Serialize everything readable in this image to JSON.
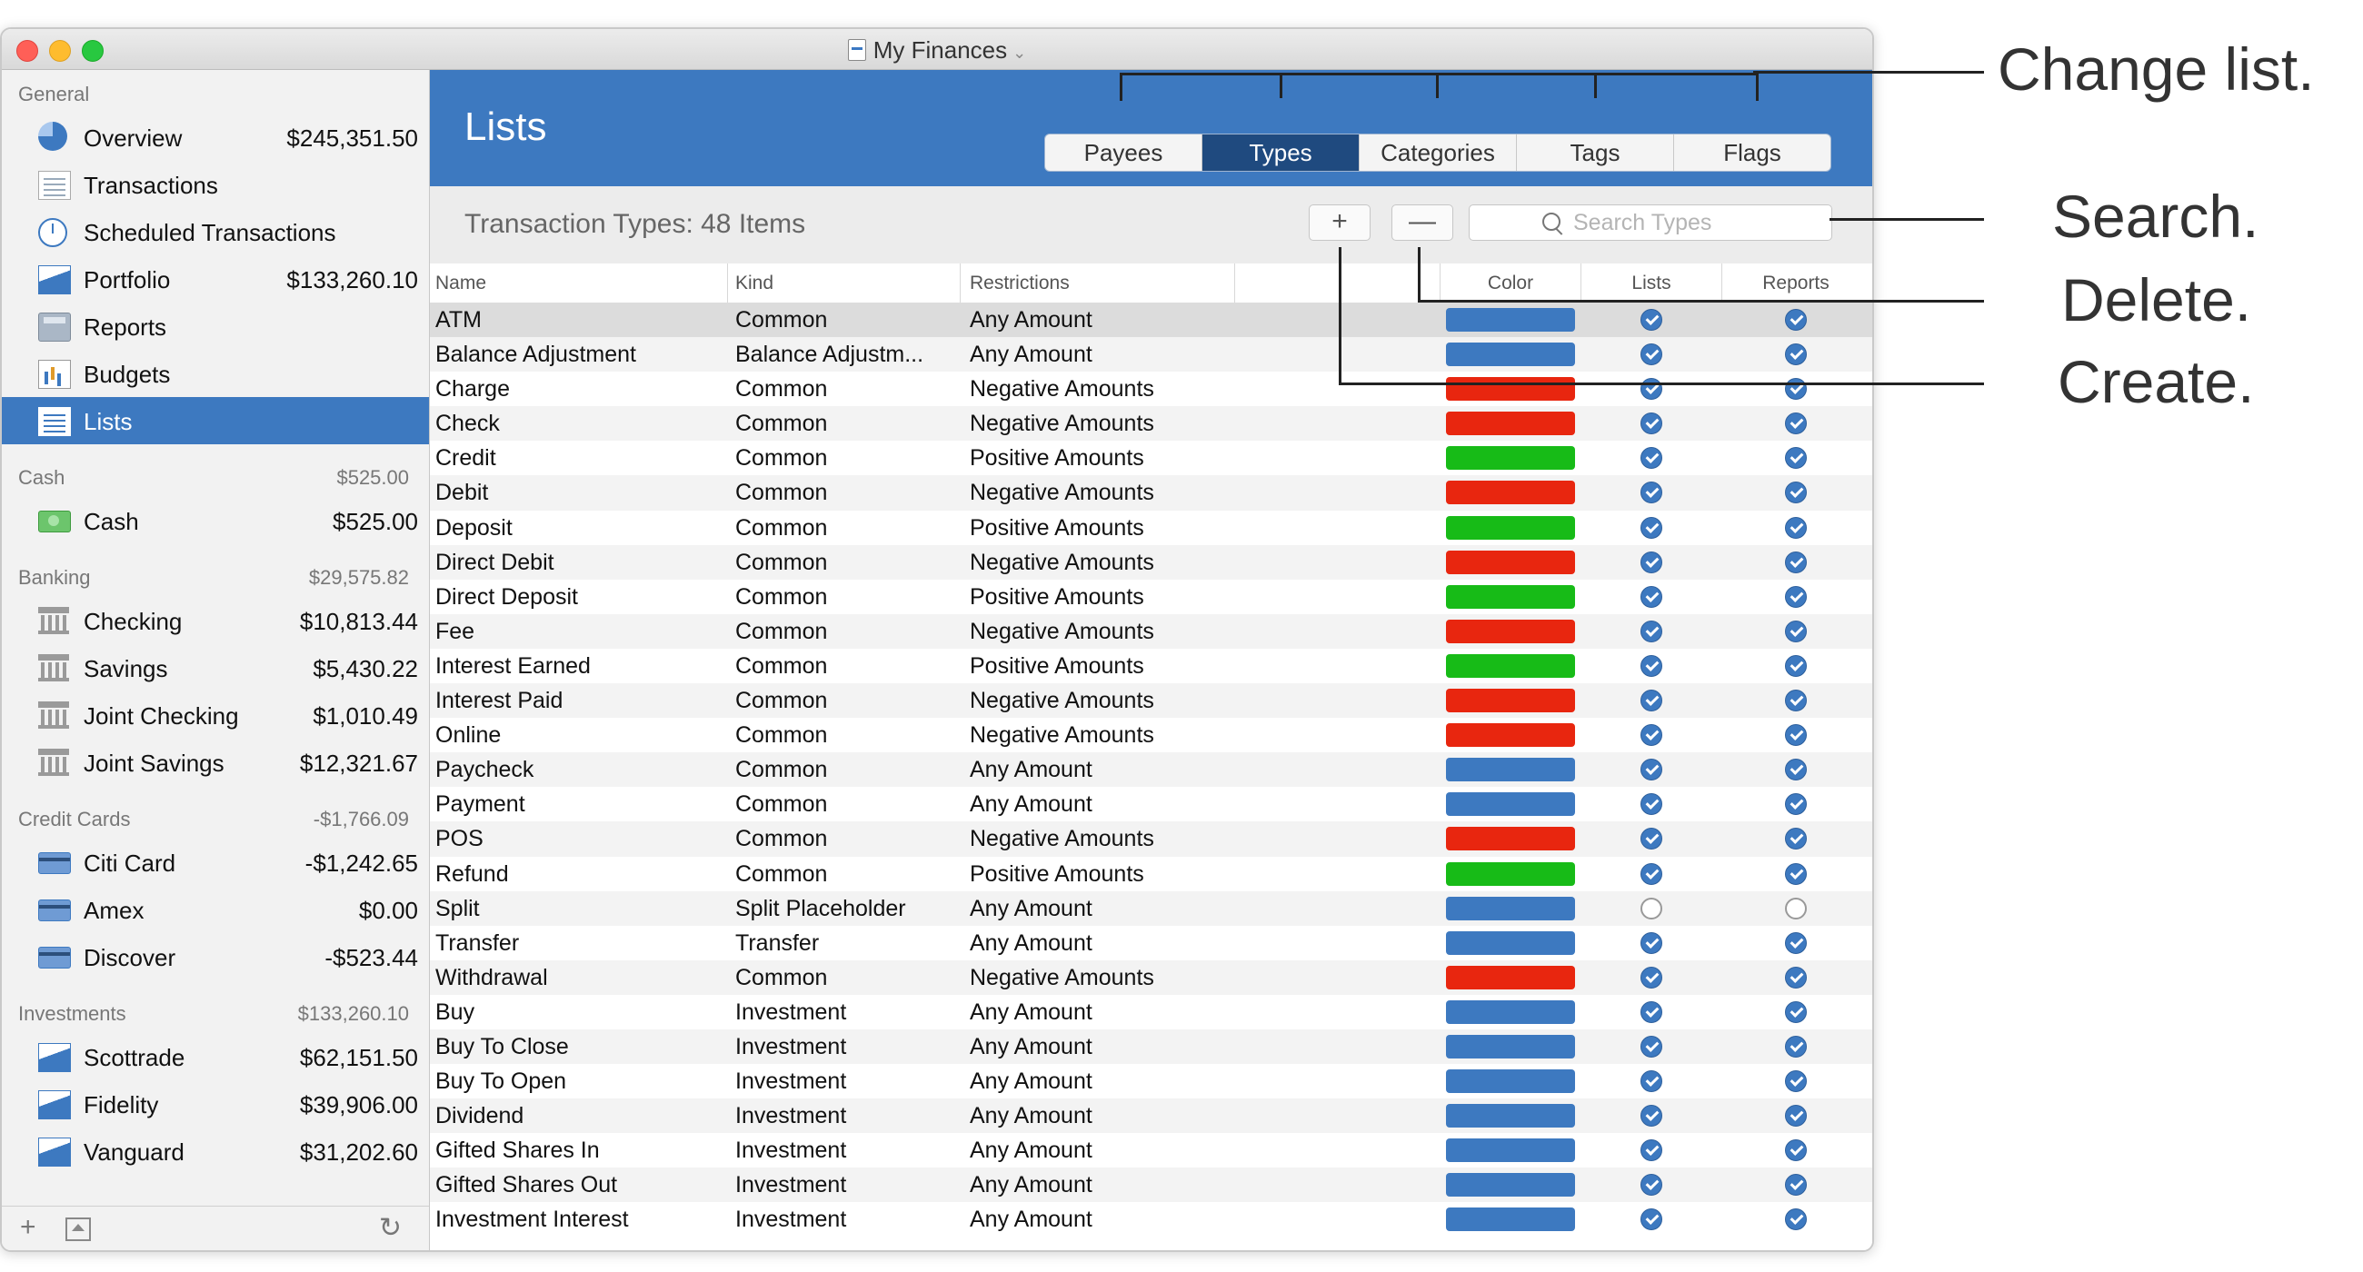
{
  "window": {
    "title": "My Finances"
  },
  "sidebar": {
    "sections": [
      {
        "name": "General",
        "total": "",
        "items": [
          {
            "label": "Overview",
            "value": "$245,351.50",
            "icon": "overview-icon"
          },
          {
            "label": "Transactions",
            "value": "",
            "icon": "transactions-icon"
          },
          {
            "label": "Scheduled Transactions",
            "value": "",
            "icon": "clock-icon"
          },
          {
            "label": "Portfolio",
            "value": "$133,260.10",
            "icon": "chart-icon"
          },
          {
            "label": "Reports",
            "value": "",
            "icon": "calculator-icon"
          },
          {
            "label": "Budgets",
            "value": "",
            "icon": "budget-icon"
          },
          {
            "label": "Lists",
            "value": "",
            "icon": "list-icon",
            "selected": true
          }
        ]
      },
      {
        "name": "Cash",
        "total": "$525.00",
        "items": [
          {
            "label": "Cash",
            "value": "$525.00",
            "icon": "cash-icon"
          }
        ]
      },
      {
        "name": "Banking",
        "total": "$29,575.82",
        "items": [
          {
            "label": "Checking",
            "value": "$10,813.44",
            "icon": "bank-icon"
          },
          {
            "label": "Savings",
            "value": "$5,430.22",
            "icon": "bank-icon"
          },
          {
            "label": "Joint Checking",
            "value": "$1,010.49",
            "icon": "bank-icon"
          },
          {
            "label": "Joint Savings",
            "value": "$12,321.67",
            "icon": "bank-icon"
          }
        ]
      },
      {
        "name": "Credit Cards",
        "total": "-$1,766.09",
        "items": [
          {
            "label": "Citi Card",
            "value": "-$1,242.65",
            "icon": "credit-card-icon"
          },
          {
            "label": "Amex",
            "value": "$0.00",
            "icon": "credit-card-icon"
          },
          {
            "label": "Discover",
            "value": "-$523.44",
            "icon": "credit-card-icon"
          }
        ]
      },
      {
        "name": "Investments",
        "total": "$133,260.10",
        "items": [
          {
            "label": "Scottrade",
            "value": "$62,151.50",
            "icon": "chart-icon"
          },
          {
            "label": "Fidelity",
            "value": "$39,906.00",
            "icon": "chart-icon"
          },
          {
            "label": "Vanguard",
            "value": "$31,202.60",
            "icon": "chart-icon"
          }
        ]
      }
    ],
    "footer": {
      "add": "+",
      "refresh": "↻"
    }
  },
  "main": {
    "title": "Lists",
    "tabs": [
      {
        "label": "Payees",
        "active": false
      },
      {
        "label": "Types",
        "active": true
      },
      {
        "label": "Categories",
        "active": false
      },
      {
        "label": "Tags",
        "active": false
      },
      {
        "label": "Flags",
        "active": false
      }
    ],
    "toolbar": {
      "title": "Transaction Types: 48 Items",
      "add_label": "+",
      "delete_label": "—",
      "search_placeholder": "Search Types"
    },
    "columns": {
      "name": "Name",
      "kind": "Kind",
      "restrictions": "Restrictions",
      "color": "Color",
      "lists": "Lists",
      "reports": "Reports"
    },
    "colors": {
      "blue": "#3d79c0",
      "red": "#e8260f",
      "green": "#17bb17"
    },
    "rows": [
      {
        "name": "ATM",
        "kind": "Common",
        "restrictions": "Any Amount",
        "color": "blue",
        "lists": true,
        "reports": true
      },
      {
        "name": "Balance Adjustment",
        "kind": "Balance Adjustm...",
        "restrictions": "Any Amount",
        "color": "blue",
        "lists": true,
        "reports": true
      },
      {
        "name": "Charge",
        "kind": "Common",
        "restrictions": "Negative Amounts",
        "color": "red",
        "lists": true,
        "reports": true
      },
      {
        "name": "Check",
        "kind": "Common",
        "restrictions": "Negative Amounts",
        "color": "red",
        "lists": true,
        "reports": true
      },
      {
        "name": "Credit",
        "kind": "Common",
        "restrictions": "Positive Amounts",
        "color": "green",
        "lists": true,
        "reports": true
      },
      {
        "name": "Debit",
        "kind": "Common",
        "restrictions": "Negative Amounts",
        "color": "red",
        "lists": true,
        "reports": true
      },
      {
        "name": "Deposit",
        "kind": "Common",
        "restrictions": "Positive Amounts",
        "color": "green",
        "lists": true,
        "reports": true
      },
      {
        "name": "Direct Debit",
        "kind": "Common",
        "restrictions": "Negative Amounts",
        "color": "red",
        "lists": true,
        "reports": true
      },
      {
        "name": "Direct Deposit",
        "kind": "Common",
        "restrictions": "Positive Amounts",
        "color": "green",
        "lists": true,
        "reports": true
      },
      {
        "name": "Fee",
        "kind": "Common",
        "restrictions": "Negative Amounts",
        "color": "red",
        "lists": true,
        "reports": true
      },
      {
        "name": "Interest Earned",
        "kind": "Common",
        "restrictions": "Positive Amounts",
        "color": "green",
        "lists": true,
        "reports": true
      },
      {
        "name": "Interest Paid",
        "kind": "Common",
        "restrictions": "Negative Amounts",
        "color": "red",
        "lists": true,
        "reports": true
      },
      {
        "name": "Online",
        "kind": "Common",
        "restrictions": "Negative Amounts",
        "color": "red",
        "lists": true,
        "reports": true
      },
      {
        "name": "Paycheck",
        "kind": "Common",
        "restrictions": "Any Amount",
        "color": "blue",
        "lists": true,
        "reports": true
      },
      {
        "name": "Payment",
        "kind": "Common",
        "restrictions": "Any Amount",
        "color": "blue",
        "lists": true,
        "reports": true
      },
      {
        "name": "POS",
        "kind": "Common",
        "restrictions": "Negative Amounts",
        "color": "red",
        "lists": true,
        "reports": true
      },
      {
        "name": "Refund",
        "kind": "Common",
        "restrictions": "Positive Amounts",
        "color": "green",
        "lists": true,
        "reports": true
      },
      {
        "name": "Split",
        "kind": "Split Placeholder",
        "restrictions": "Any Amount",
        "color": "blue",
        "lists": false,
        "reports": false
      },
      {
        "name": "Transfer",
        "kind": "Transfer",
        "restrictions": "Any Amount",
        "color": "blue",
        "lists": true,
        "reports": true
      },
      {
        "name": "Withdrawal",
        "kind": "Common",
        "restrictions": "Negative Amounts",
        "color": "red",
        "lists": true,
        "reports": true
      },
      {
        "name": "Buy",
        "kind": "Investment",
        "restrictions": "Any Amount",
        "color": "blue",
        "lists": true,
        "reports": true
      },
      {
        "name": "Buy To Close",
        "kind": "Investment",
        "restrictions": "Any Amount",
        "color": "blue",
        "lists": true,
        "reports": true
      },
      {
        "name": "Buy To Open",
        "kind": "Investment",
        "restrictions": "Any Amount",
        "color": "blue",
        "lists": true,
        "reports": true
      },
      {
        "name": "Dividend",
        "kind": "Investment",
        "restrictions": "Any Amount",
        "color": "blue",
        "lists": true,
        "reports": true
      },
      {
        "name": "Gifted Shares In",
        "kind": "Investment",
        "restrictions": "Any Amount",
        "color": "blue",
        "lists": true,
        "reports": true
      },
      {
        "name": "Gifted Shares Out",
        "kind": "Investment",
        "restrictions": "Any Amount",
        "color": "blue",
        "lists": true,
        "reports": true
      },
      {
        "name": "Investment Interest",
        "kind": "Investment",
        "restrictions": "Any Amount",
        "color": "blue",
        "lists": true,
        "reports": true
      }
    ]
  },
  "callouts": {
    "change_list": "Change list.",
    "search": "Search.",
    "delete": "Delete.",
    "create": "Create."
  }
}
